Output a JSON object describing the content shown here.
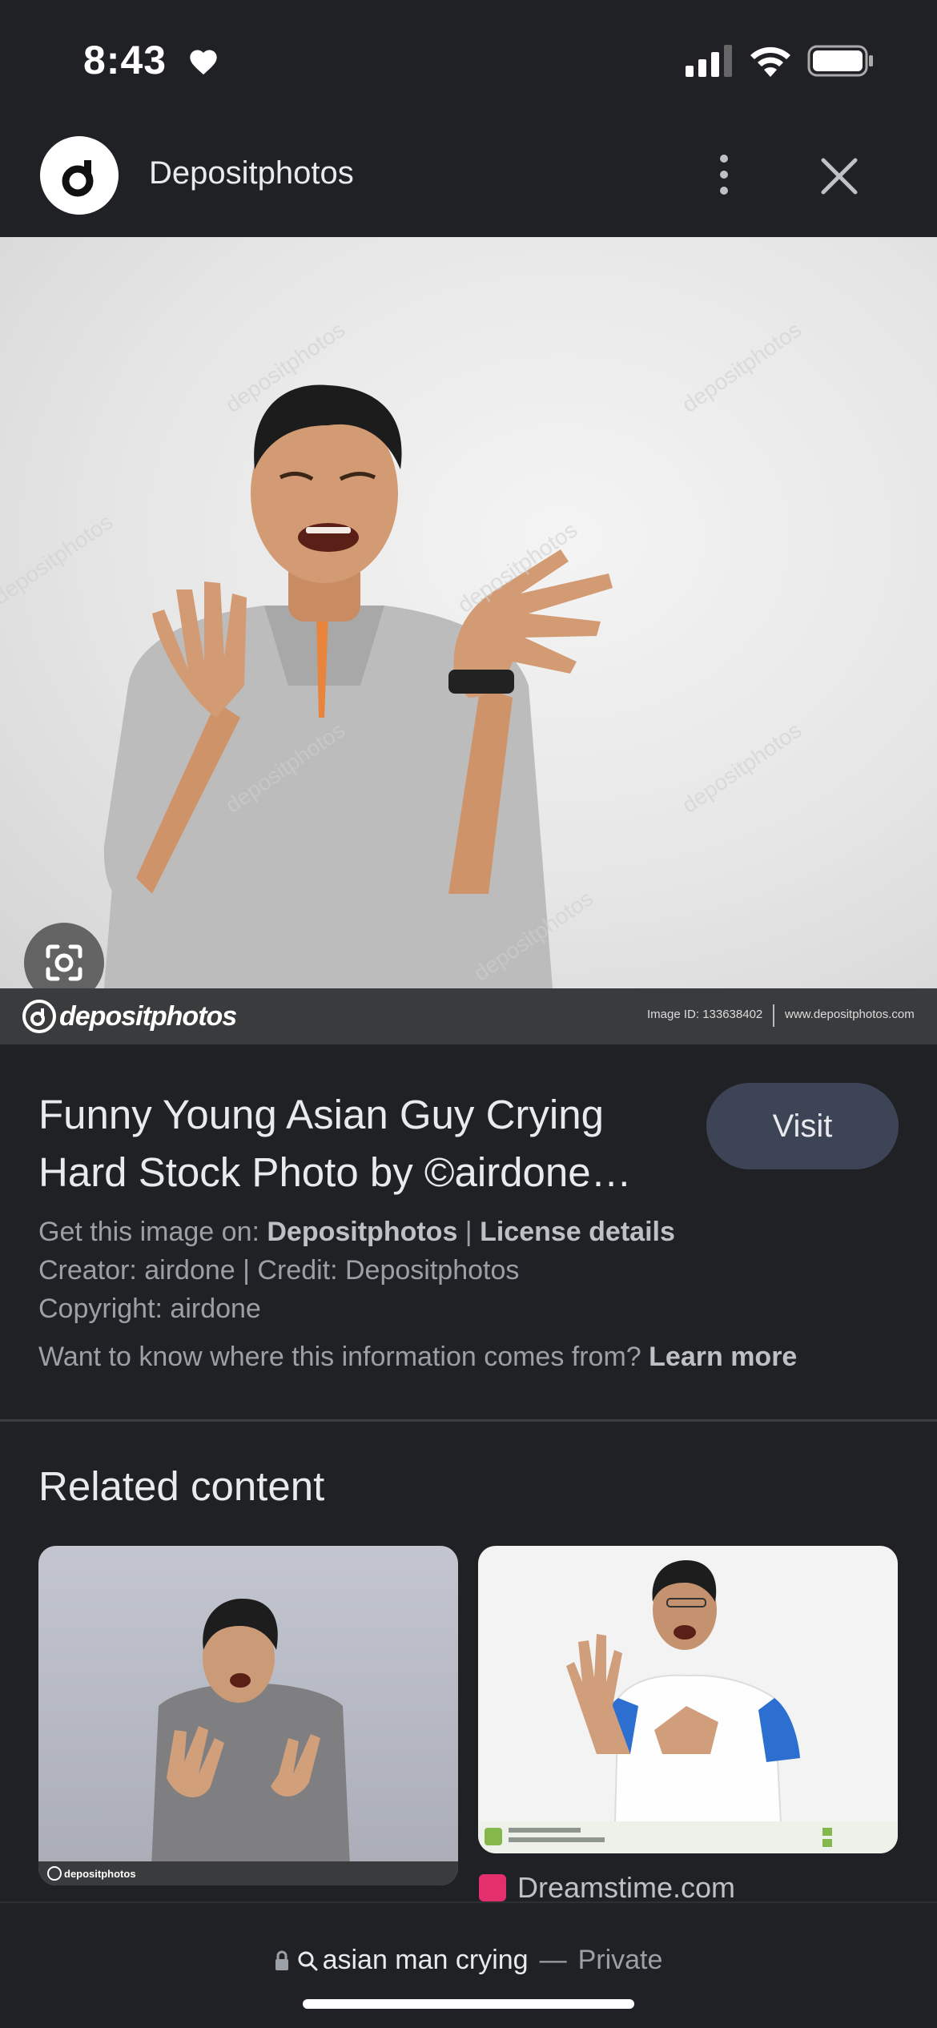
{
  "status_bar": {
    "time": "8:43",
    "icons": [
      "heart-icon",
      "signal-icon",
      "wifi-icon",
      "battery-icon"
    ]
  },
  "header": {
    "site_name": "Depositphotos",
    "logo_icon": "depositphotos-logo-icon",
    "more_icon": "more-vert-icon",
    "close_icon": "close-icon"
  },
  "image": {
    "watermark_brand": "depositphotos",
    "image_id": "Image ID: 133638402",
    "site_url": "www.depositphotos.com",
    "lens_icon": "lens-icon"
  },
  "info": {
    "title": "Funny Young Asian Guy Crying Hard Stock Photo by ©airdone…",
    "visit_label": "Visit",
    "get_image_prefix": "Get this image on: ",
    "get_image_source": "Depositphotos",
    "separator": " | ",
    "license_link": "License details",
    "creator_credit": "Creator: airdone | Credit: Depositphotos",
    "copyright": "Copyright: airdone",
    "info_question": "Want to know where this information comes from? ",
    "learn_more": "Learn more"
  },
  "related": {
    "heading": "Related content",
    "items": [
      {
        "source": "depositphotos"
      },
      {
        "source": "Dreamstime.com"
      }
    ]
  },
  "bottom_bar": {
    "query": "asian man crying",
    "separator": "—",
    "mode": "Private"
  },
  "colors": {
    "background": "#202124",
    "button_bg": "#3c4455",
    "text_primary": "#e8eaed",
    "text_secondary": "#9aa0a6",
    "dreamstime_brand": "#e3306c"
  }
}
